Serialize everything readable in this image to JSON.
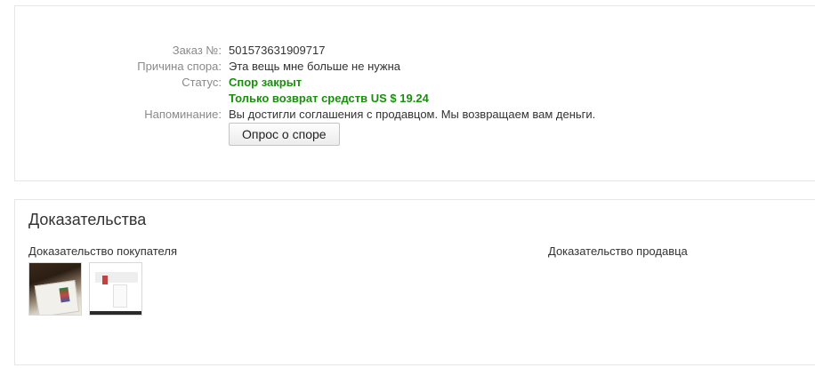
{
  "dispute": {
    "order_label": "Заказ №:",
    "order_value": "501573631909717",
    "reason_label": "Причина спора:",
    "reason_value": "Эта вещь мне больше не нужна",
    "status_label": "Статус:",
    "status_value": "Спор закрыт",
    "refund_value": "Только возврат средств US $ 19.24",
    "reminder_label": "Напоминание:",
    "reminder_value": "Вы достигли соглашения с продавцом. Мы возвращаем вам деньги.",
    "survey_button": "Опрос о споре",
    "status_color": "#1a8f0e"
  },
  "evidence": {
    "title": "Доказательства",
    "buyer_title": "Доказательство покупателя",
    "seller_title": "Доказательство продавца",
    "buyer_images": [
      "photo-thumbnail",
      "screenshot-thumbnail"
    ]
  }
}
